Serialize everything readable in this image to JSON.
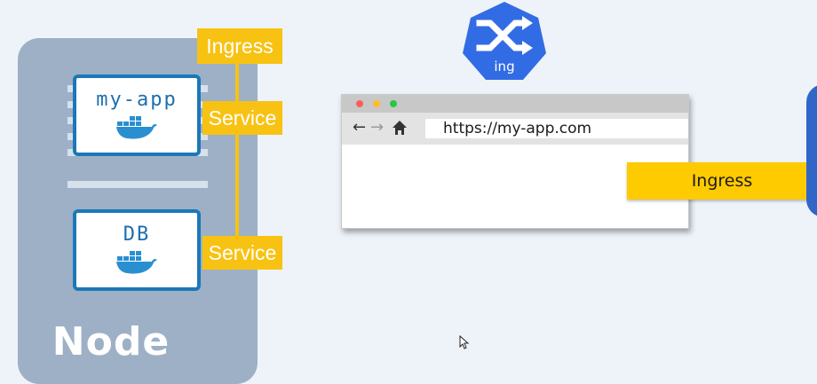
{
  "node": {
    "label": "Node"
  },
  "apps": [
    {
      "name": "my-app"
    },
    {
      "name": "DB"
    }
  ],
  "tags": {
    "ingress": "Ingress",
    "service_app": "Service",
    "service_db": "Service"
  },
  "logo": {
    "text": "ing"
  },
  "browser": {
    "url": "https://my-app.com"
  },
  "banner": {
    "label": "Ingress"
  },
  "colors": {
    "node_bg": "#9db0c6",
    "tag_yellow": "#f8c212",
    "banner_yellow": "#fecb00",
    "k8s_blue": "#326ce5",
    "app_border": "#1b78b8"
  }
}
